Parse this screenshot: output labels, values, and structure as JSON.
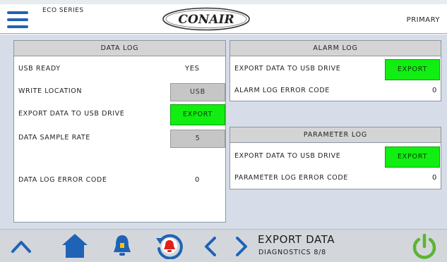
{
  "header": {
    "series": "ECO SERIES",
    "logo_text": "CONAIR",
    "mode": "PRIMARY"
  },
  "data_log": {
    "title": "DATA LOG",
    "usb_ready_label": "USB READY",
    "usb_ready_value": "YES",
    "write_location_label": "WRITE LOCATION",
    "write_location_value": "USB",
    "export_label": "EXPORT DATA TO USB DRIVE",
    "export_button": "EXPORT",
    "sample_rate_label": "DATA SAMPLE RATE",
    "sample_rate_value": "5",
    "error_label": "DATA LOG ERROR CODE",
    "error_value": "0"
  },
  "alarm_log": {
    "title": "ALARM LOG",
    "export_label": "EXPORT DATA TO USB DRIVE",
    "export_button": "EXPORT",
    "error_label": "ALARM LOG ERROR CODE",
    "error_value": "0"
  },
  "parameter_log": {
    "title": "PARAMETER LOG",
    "export_label": "EXPORT DATA TO USB DRIVE",
    "export_button": "EXPORT",
    "error_label": "PARAMETER LOG ERROR CODE",
    "error_value": "0"
  },
  "footer": {
    "title": "EXPORT DATA",
    "subtitle": "DIAGNOSTICS 8/8",
    "icons": [
      "chevron-up-icon",
      "home-icon",
      "bell-icon",
      "alarm-history-icon",
      "chevron-left-icon",
      "chevron-right-icon",
      "power-icon"
    ]
  },
  "colors": {
    "accent_blue": "#1f63b6",
    "export_green": "#11ee11",
    "alarm_red": "#e0201b",
    "power_green": "#5cb531",
    "panel_bg": "#d6dde8"
  }
}
